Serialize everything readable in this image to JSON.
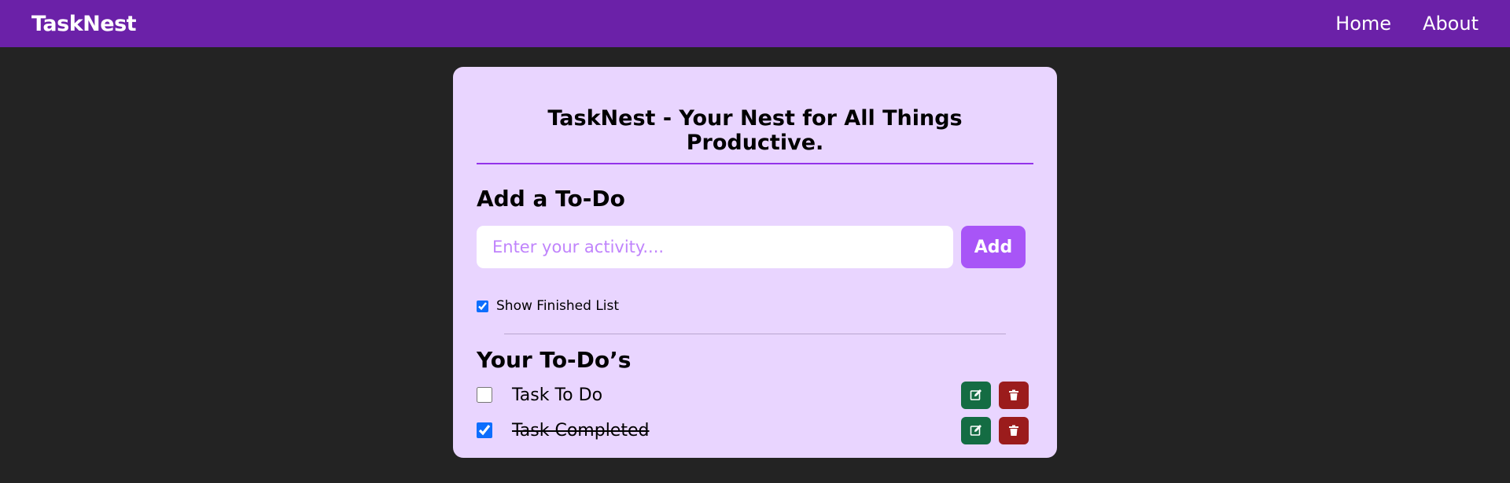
{
  "nav": {
    "brand": "TaskNest",
    "links": [
      "Home",
      "About"
    ]
  },
  "card": {
    "title": "TaskNest - Your Nest for All Things Productive."
  },
  "add_section": {
    "heading": "Add a To-Do",
    "input_value": "",
    "placeholder": "Enter your activity....",
    "button_label": "Add"
  },
  "show_finished": {
    "label": "Show Finished List",
    "checked": true
  },
  "todos": {
    "heading": "Your To-Do’s",
    "items": [
      {
        "text": "Task To Do",
        "completed": false
      },
      {
        "text": "Task Completed",
        "completed": true
      }
    ]
  },
  "icons": {
    "edit": "edit-icon",
    "delete": "trash-icon"
  },
  "colors": {
    "nav_bg": "#6b21a8",
    "card_bg": "#e9d5ff",
    "accent": "#a855f7",
    "edit": "#146c43",
    "delete": "#9b1c1c"
  }
}
